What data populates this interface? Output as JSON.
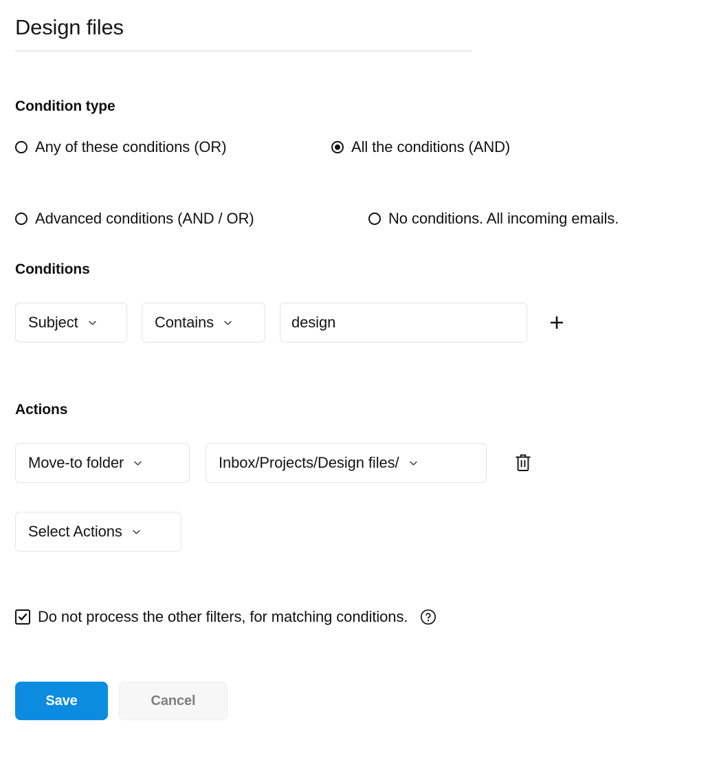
{
  "header": {
    "title": "Design files"
  },
  "condition_type": {
    "heading": "Condition type",
    "options": [
      {
        "label": "Any of these conditions (OR)",
        "selected": false
      },
      {
        "label": "All the conditions (AND)",
        "selected": true
      },
      {
        "label": "Advanced conditions (AND / OR)",
        "selected": false
      },
      {
        "label": "No conditions. All incoming emails.",
        "selected": false
      }
    ]
  },
  "conditions": {
    "heading": "Conditions",
    "rows": [
      {
        "field": "Subject",
        "operator": "Contains",
        "value": "design",
        "value_placeholder": "",
        "add_icon": "plus-icon"
      }
    ]
  },
  "actions": {
    "heading": "Actions",
    "rows": [
      {
        "action": "Move-to folder",
        "target": "Inbox/Projects/Design files/",
        "delete_icon": "trash-icon"
      }
    ],
    "add_action_label": "Select Actions"
  },
  "options": {
    "stop_processing": {
      "label": "Do not process the other filters, for matching conditions.",
      "checked": true,
      "help_icon": "help-circle-icon"
    }
  },
  "footer": {
    "save_label": "Save",
    "cancel_label": "Cancel"
  },
  "colors": {
    "accent": "#0c8ce0",
    "save_text": "#ffffff",
    "cancel_bg": "#f7f7f7",
    "cancel_text": "#7f7f7f",
    "border": "#e3e3e3",
    "divider": "#e6e6e6",
    "text": "#111111"
  },
  "icons": {
    "chevron_down": "chevron-down-icon"
  }
}
